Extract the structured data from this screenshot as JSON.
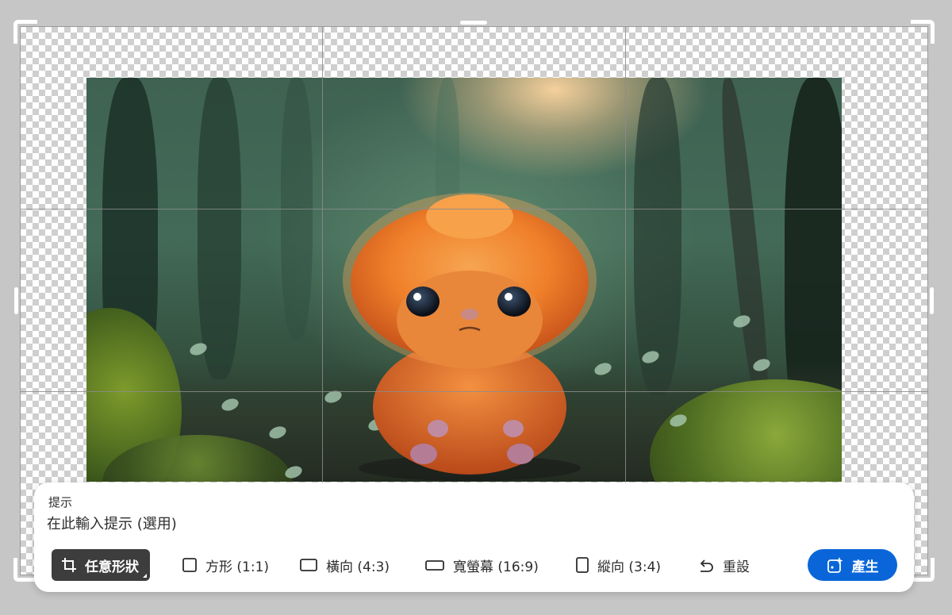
{
  "prompt": {
    "label": "提示",
    "placeholder": "在此輸入提示 (選用)"
  },
  "toolbar": {
    "items": [
      {
        "label": "任意形狀",
        "icon": "crop-icon",
        "active": true
      },
      {
        "label": "方形 (1:1)",
        "icon": "square-icon",
        "active": false
      },
      {
        "label": "橫向 (4:3)",
        "icon": "landscape-icon",
        "active": false
      },
      {
        "label": "寬螢幕 (16:9)",
        "icon": "widescreen-icon",
        "active": false
      },
      {
        "label": "縱向 (3:4)",
        "icon": "portrait-icon",
        "active": false
      },
      {
        "label": "重設",
        "icon": "undo-icon",
        "active": false
      }
    ],
    "generate_label": "產生",
    "generate_icon": "sparkle-generate-icon"
  },
  "colors": {
    "accent": "#0a66d8",
    "active_tool": "#3d3d3d",
    "canvas_bg": "#c6c6c6",
    "creature_fur": "#f0802a"
  }
}
